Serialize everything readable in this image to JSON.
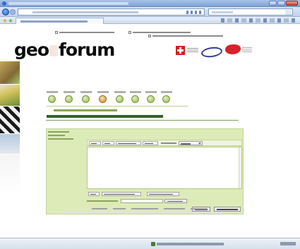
{
  "browser": {
    "title": "",
    "url": "",
    "search_placeholder": "",
    "tab_title": ""
  },
  "site": {
    "logo_text_left": "geo",
    "logo_text_right": "forum",
    "breadcrumb": "",
    "headline": ""
  },
  "top_links": [
    {
      "label": ""
    },
    {
      "label": ""
    },
    {
      "label": ""
    }
  ],
  "nav_items": [
    {
      "label": "",
      "active": false
    },
    {
      "label": "",
      "active": false
    },
    {
      "label": "",
      "active": false
    },
    {
      "label": "",
      "active": true
    },
    {
      "label": "",
      "active": false
    },
    {
      "label": "",
      "active": false
    },
    {
      "label": "",
      "active": false
    },
    {
      "label": "",
      "active": false
    }
  ],
  "form": {
    "labels": [
      "",
      "",
      ""
    ],
    "toolbar_buttons": [
      "",
      "",
      "",
      ""
    ],
    "font_label": "",
    "font_select_value": "",
    "textarea_value": "",
    "below_buttons": [
      "",
      "",
      ""
    ],
    "file_label": "",
    "file_value": "",
    "file_button": "",
    "preview_button": "",
    "submit_button": ""
  },
  "footer_links": [
    "",
    "",
    "",
    "",
    ""
  ],
  "status": {
    "zone_text": "",
    "zoom": ""
  },
  "colors": {
    "form_bg": "#dcebb7",
    "accent_green": "#355f2c",
    "flag_red": "#d5201f",
    "ring_blue": "#2a3e9a"
  }
}
